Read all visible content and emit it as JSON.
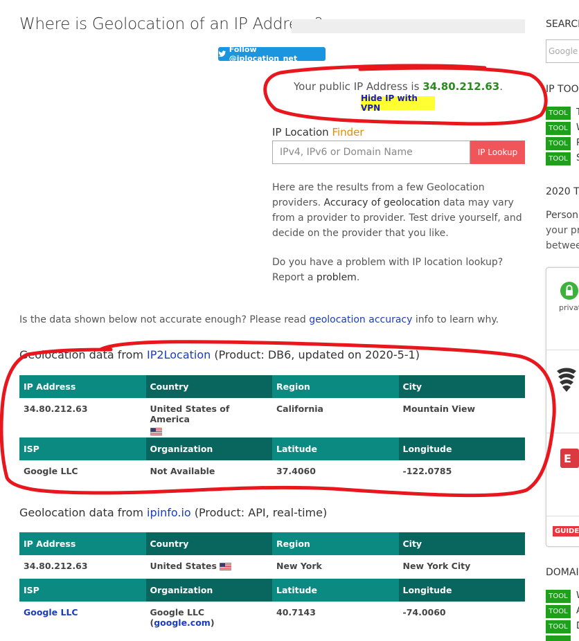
{
  "page": {
    "title": "Where is Geolocation of an IP Address?",
    "twitter_label": "Follow @iplocation_net"
  },
  "ip_box": {
    "prefix": "Your public IP Address is ",
    "ip": "34.80.212.63",
    "suffix": ".",
    "hide_vpn": "Hide IP with VPN"
  },
  "finder": {
    "label": "IP Location ",
    "label_accent": "Finder",
    "placeholder": "IPv4, IPv6 or Domain Name",
    "button": "IP Lookup"
  },
  "intro": {
    "p1_a": "Here are the results from a few Geolocation providers. ",
    "p1_b": "Accuracy of geolocation",
    "p1_c": " data may vary from a provider to provider. Test drive yourself, and decide on the provider that you like.",
    "p2_a": "Do you have a problem with IP location lookup? Report a ",
    "p2_b": "problem",
    "p2_c": "."
  },
  "accuracy_note": {
    "before": "Is the data shown below not accurate enough? Please read ",
    "link": "geolocation accuracy",
    "after": " info to learn why."
  },
  "providers": [
    {
      "prefix": "Geolocation data from ",
      "name": "IP2Location",
      "suffix": " (Product: DB6, updated on 2020-5-1)",
      "headers1": [
        "IP Address",
        "Country",
        "Region",
        "City"
      ],
      "row1": [
        "34.80.212.63",
        "United States of America",
        "California",
        "Mountain View"
      ],
      "headers2": [
        "ISP",
        "Organization",
        "Latitude",
        "Longitude"
      ],
      "row2": [
        "Google LLC",
        "Not Available",
        "37.4060",
        "-122.0785"
      ]
    },
    {
      "prefix": "Geolocation data from ",
      "name": "ipinfo.io",
      "suffix": " (Product: API, real-time)",
      "headers1": [
        "IP Address",
        "Country",
        "Region",
        "City"
      ],
      "row1": [
        "34.80.212.63",
        "United States",
        "New York",
        "New York City"
      ],
      "headers2": [
        "ISP",
        "Organization",
        "Latitude",
        "Longitude"
      ],
      "row2_isp": "Google LLC",
      "row2_org_a": "Google LLC (",
      "row2_org_link": "google.com",
      "row2_org_b": ")",
      "row2_lat": "40.7143",
      "row2_lon": "-74.0060"
    }
  ],
  "sidebar": {
    "search_title": "SEARCH",
    "search_placeholder": "Google",
    "tools_title": "IP TOOL",
    "tool_badge": "TOOL",
    "tool_letters_top": [
      "T",
      "W",
      "P",
      "S"
    ],
    "heading_2020": "2020 T",
    "persona_lines": [
      "Person",
      "your pr",
      "betwee"
    ],
    "ad_private": "privat",
    "ad_guide": "GUIDE",
    "domain_title": "DOMAI",
    "tool_letters_bottom": [
      "W",
      "A",
      "D",
      ""
    ]
  },
  "colors": {
    "table_header_a": "#0b8a82",
    "table_header_b": "#09665f",
    "ip_green": "#2a8a1f",
    "link_blue": "#1a3cbf",
    "lookup_red": "#f0555a",
    "tool_green": "#1ea01a",
    "annotation_red": "#e8171e"
  }
}
